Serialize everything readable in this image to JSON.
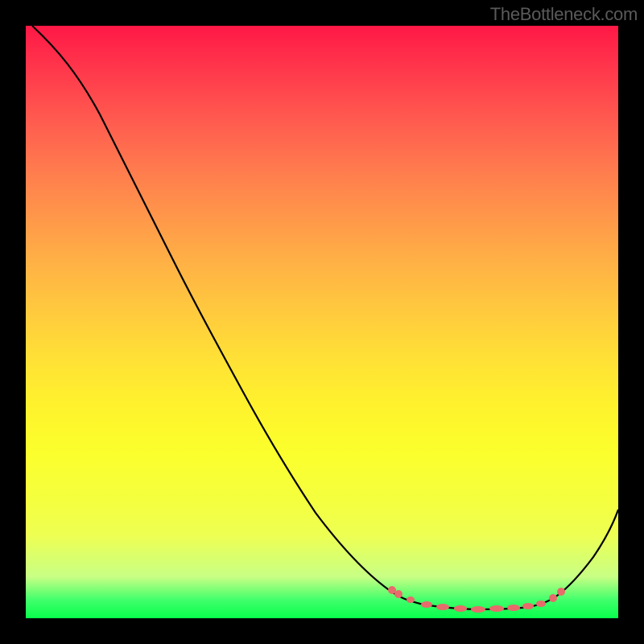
{
  "watermark": "TheBottleneck.com",
  "chart_data": {
    "type": "line",
    "title": "",
    "xlabel": "",
    "ylabel": "",
    "xlim": [
      0,
      100
    ],
    "ylim": [
      0,
      100
    ],
    "gradient_colors": {
      "top": "#ff1846",
      "bottom": "#08ff4c",
      "meaning": "red=high bottleneck, green=optimal"
    },
    "series": [
      {
        "name": "bottleneck-curve",
        "x": [
          0,
          5,
          10,
          15,
          20,
          25,
          30,
          35,
          40,
          45,
          50,
          55,
          60,
          62,
          64,
          66,
          68,
          70,
          72,
          74,
          76,
          78,
          80,
          82,
          84,
          86,
          88,
          90,
          93,
          96,
          100
        ],
        "y": [
          100,
          95,
          89,
          82,
          75,
          68,
          60,
          52,
          44,
          36,
          28,
          20,
          12,
          9,
          7,
          5.5,
          4.5,
          3.8,
          3.2,
          2.7,
          2.3,
          2.1,
          2.0,
          2.1,
          2.3,
          2.7,
          3.5,
          5,
          8,
          12,
          18
        ]
      }
    ],
    "optimal_zone": {
      "x_range": [
        62,
        90
      ],
      "marker_color": "#e76b6b",
      "marker_points_x": [
        62,
        63,
        65,
        68,
        70,
        72,
        74,
        76,
        78,
        80,
        82,
        84,
        86,
        88,
        89,
        90
      ]
    }
  }
}
